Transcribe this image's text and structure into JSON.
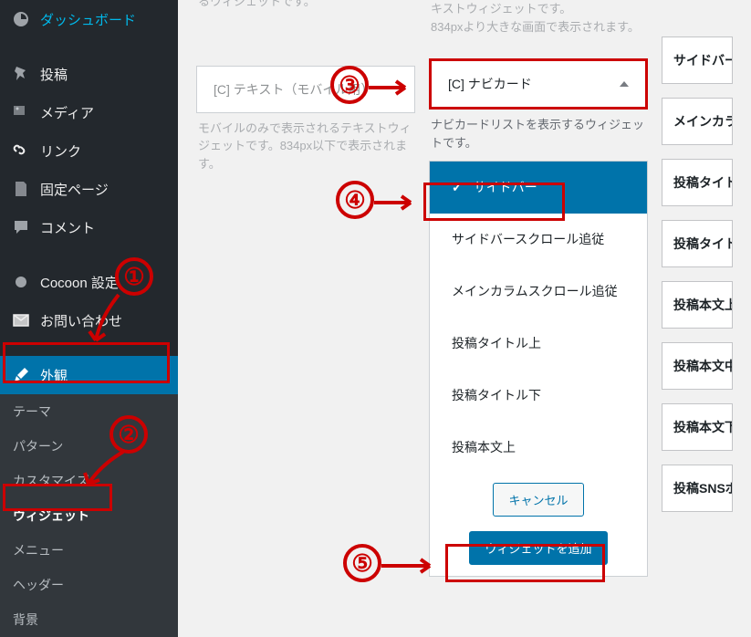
{
  "sidebar": {
    "items": [
      {
        "label": "ダッシュボード",
        "icon": "dashboard"
      },
      {
        "label": "投稿",
        "icon": "pin"
      },
      {
        "label": "メディア",
        "icon": "media"
      },
      {
        "label": "リンク",
        "icon": "link"
      },
      {
        "label": "固定ページ",
        "icon": "page"
      },
      {
        "label": "コメント",
        "icon": "comment"
      },
      {
        "label": "Cocoon 設定",
        "icon": "circle"
      },
      {
        "label": "お問い合わせ",
        "icon": "mail"
      },
      {
        "label": "外観",
        "icon": "brush",
        "active": true
      }
    ],
    "submenu": [
      {
        "label": "テーマ"
      },
      {
        "label": "パターン"
      },
      {
        "label": "カスタマイズ"
      },
      {
        "label": "ウィジェット",
        "current": true
      },
      {
        "label": "メニュー"
      },
      {
        "label": "ヘッダー"
      },
      {
        "label": "背景"
      }
    ]
  },
  "widgets": {
    "left": {
      "partial_desc_top": "るウィジェットです。",
      "box1_title": "[C] テキスト（モバイル用）",
      "box1_desc": "モバイルのみで表示されるテキストウィジェットです。834px以下で表示されます。"
    },
    "right": {
      "partial_desc_top1": "キストウィジェットです。",
      "partial_desc_top2": "834pxより大きな画面で表示されます。",
      "box1_title": "[C] ナビカード",
      "box1_desc": "ナビカードリストを表示するウィジェットです。"
    }
  },
  "placement": {
    "items": [
      "サイドバー",
      "サイドバースクロール追従",
      "メインカラムスクロール追従",
      "投稿タイトル上",
      "投稿タイトル下",
      "投稿本文上"
    ],
    "cancel": "キャンセル",
    "add": "ウィジェットを追加"
  },
  "areas": [
    "サイドバー",
    "メインカラムスクロール追従",
    "投稿タイトル上",
    "投稿タイトル下",
    "投稿本文上",
    "投稿本文中",
    "投稿本文下",
    "投稿SNSボタン上"
  ],
  "annotations": {
    "n1": "①",
    "n2": "②",
    "n3": "③",
    "n4": "④",
    "n5": "⑤"
  }
}
